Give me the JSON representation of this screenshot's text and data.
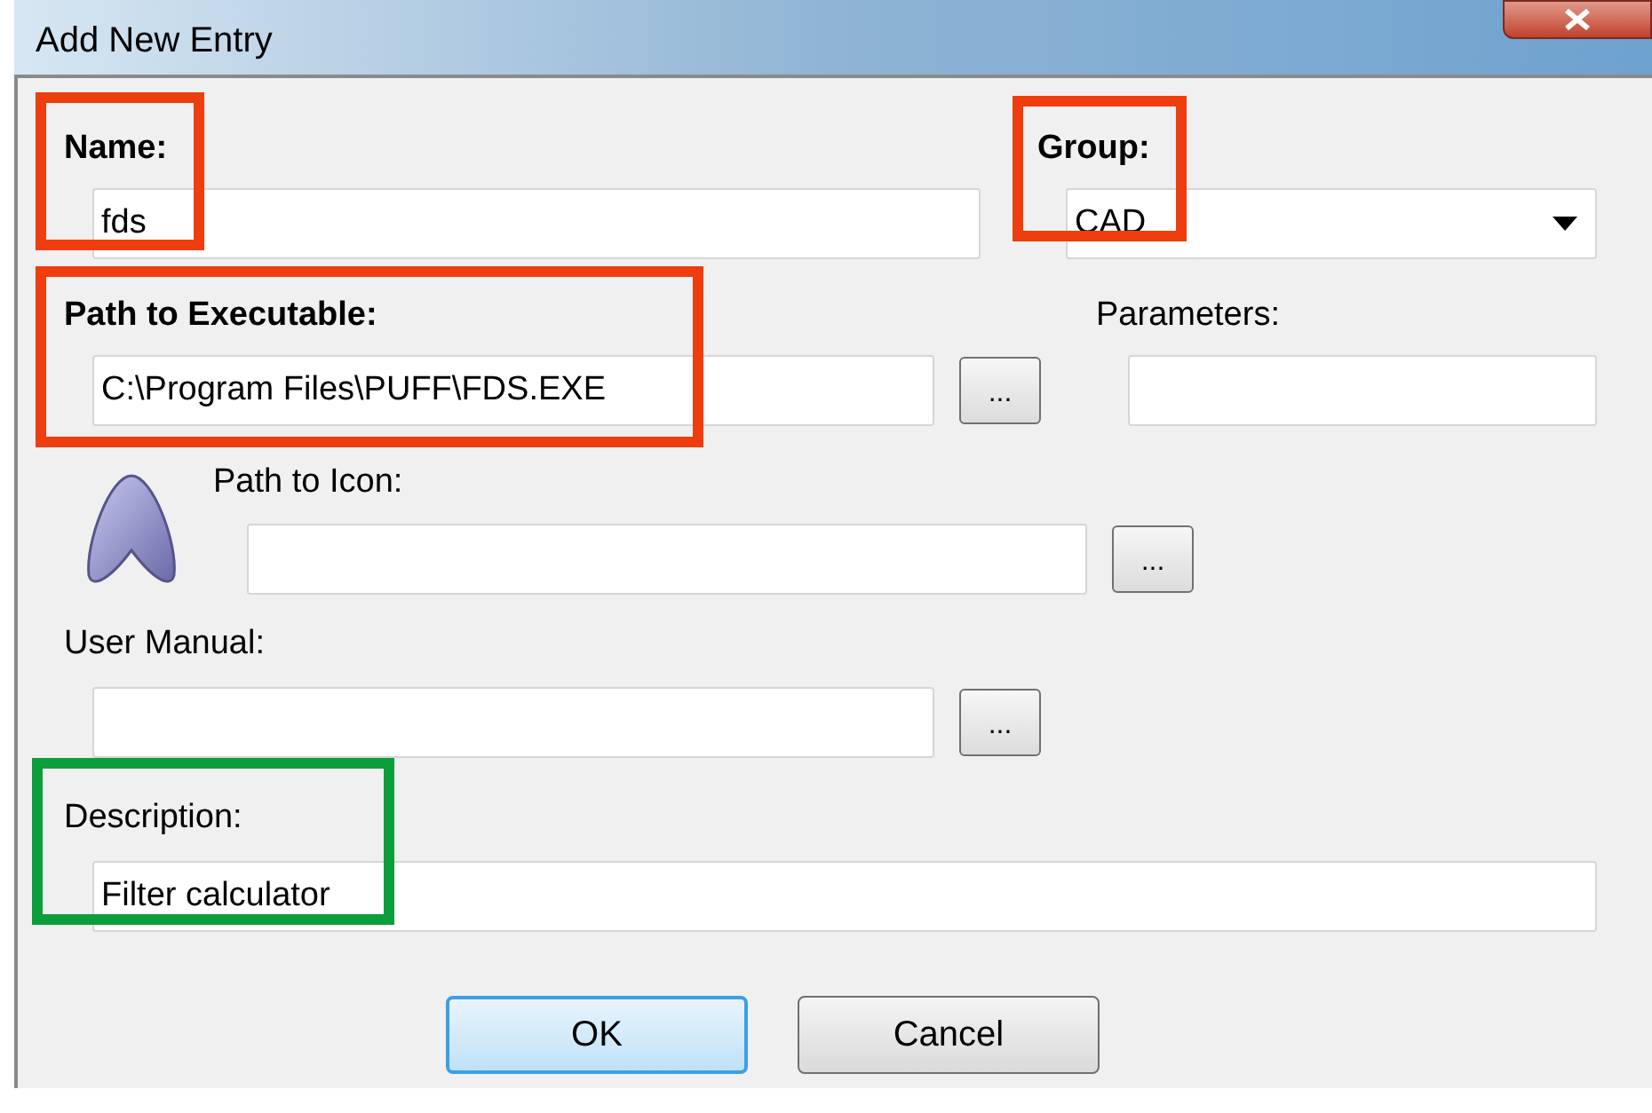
{
  "window": {
    "title": "Add New Entry"
  },
  "name": {
    "label": "Name:",
    "bold": true,
    "value": "fds",
    "highlight": {
      "color": "#ee3d0e"
    }
  },
  "group": {
    "label": "Group:",
    "bold": true,
    "value": "CAD",
    "highlight": {
      "color": "#ee3d0e"
    }
  },
  "executable": {
    "label": "Path to Executable:",
    "bold": true,
    "value": "C:\\Program Files\\PUFF\\FDS.EXE",
    "browse": "...",
    "highlight": {
      "color": "#ee3d0e"
    }
  },
  "parameters": {
    "label": "Parameters:",
    "bold": false
  },
  "icon_path": {
    "label": "Path to Icon:",
    "bold": false,
    "browse": "..."
  },
  "manual": {
    "label": "User Manual:",
    "bold": false,
    "browse": "..."
  },
  "description": {
    "label": "Description:",
    "bold": false,
    "value": "Filter calculator",
    "highlight": {
      "color": "#0d9e3c"
    }
  },
  "buttons": [
    {
      "label": "OK",
      "default": true
    },
    {
      "label": "Cancel",
      "default": false
    }
  ]
}
